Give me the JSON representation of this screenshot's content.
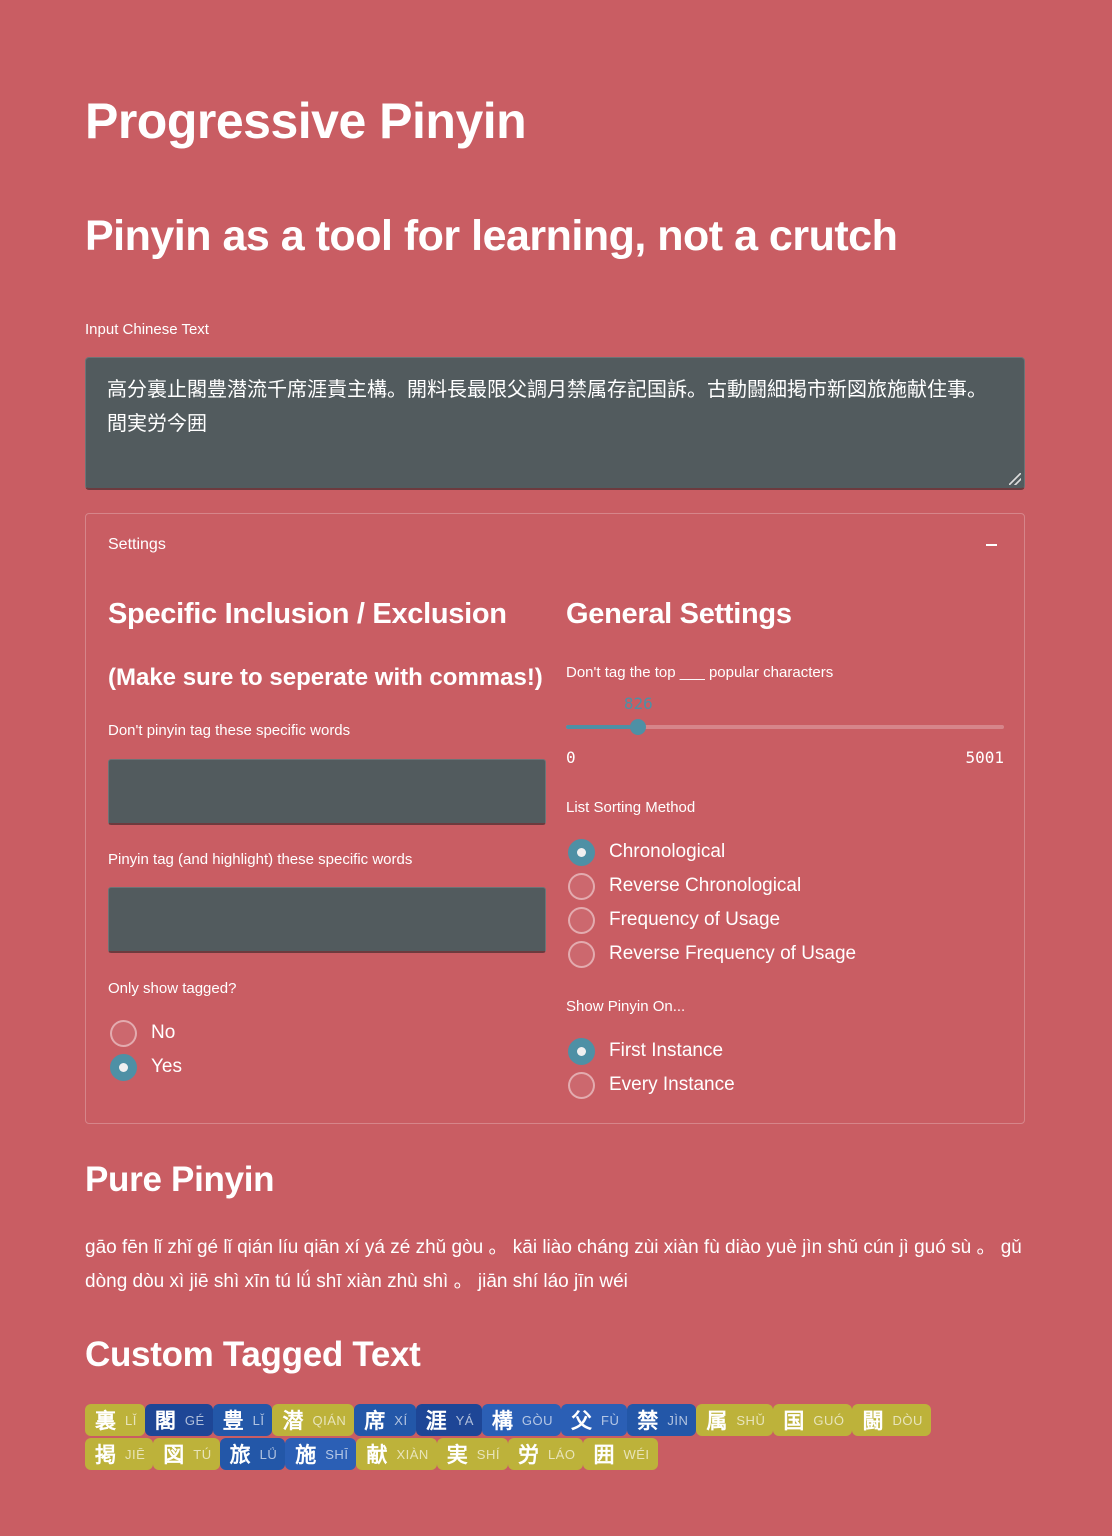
{
  "app": {
    "title": "Progressive Pinyin",
    "subtitle": "Pinyin as a tool for learning, not a crutch"
  },
  "colors": {
    "background": "#c95d63",
    "accent": "#4e90a5",
    "input_bg": "#525b5e",
    "tag_untagged": "#bdb23a",
    "tag_blue_dark": "#1e4696",
    "tag_blue_mid": "#2357a8",
    "tag_blue_light": "#2b5fb5"
  },
  "input": {
    "label": "Input Chinese Text",
    "value": "高分裏止閣豊潜流千席涯責主構。開料長最限父調月禁属存記国訴。古動闘細掲市新図旅施献住事。間実労今囲"
  },
  "settings": {
    "header": "Settings",
    "collapse_icon": "minus-icon",
    "left": {
      "heading": "Specific Inclusion / Exclusion",
      "subheading": "(Make sure to seperate with commas!)",
      "exclude_label": "Don't pinyin tag these specific words",
      "exclude_value": "",
      "include_label": "Pinyin tag (and highlight) these specific words",
      "include_value": "",
      "only_tagged": {
        "label": "Only show tagged?",
        "options": [
          "No",
          "Yes"
        ],
        "selected": "Yes"
      }
    },
    "right": {
      "heading": "General Settings",
      "slider": {
        "label": "Don't tag the top ___ popular characters",
        "value": 826,
        "min": 0,
        "max": 5001,
        "value_text": "826",
        "min_text": "0",
        "max_text": "5001"
      },
      "sorting": {
        "label": "List Sorting Method",
        "options": [
          "Chronological",
          "Reverse Chronological",
          "Frequency of Usage",
          "Reverse Frequency of Usage"
        ],
        "selected": "Chronological"
      },
      "show_pinyin": {
        "label": "Show Pinyin On...",
        "options": [
          "First Instance",
          "Every Instance"
        ],
        "selected": "First Instance"
      }
    }
  },
  "pure_pinyin": {
    "heading": "Pure Pinyin",
    "text": "gāo fēn lǐ zhǐ gé lǐ qián líu qiān xí yá zé zhǔ gòu 。 kāi liào cháng zùi xiàn fù diào yuè jìn shǔ cún jì guó sù 。 gǔ dòng dòu xì jiē shì xīn tú lǘ shī xiàn zhù shì 。 jiān shí láo jīn wéi"
  },
  "custom_tagged": {
    "heading": "Custom Tagged Text",
    "tags": [
      {
        "hanzi": "裏",
        "pinyin": "lǐ",
        "color": "olive"
      },
      {
        "hanzi": "閣",
        "pinyin": "gé",
        "color": "blue_dark"
      },
      {
        "hanzi": "豊",
        "pinyin": "lǐ",
        "color": "blue_mid"
      },
      {
        "hanzi": "潜",
        "pinyin": "qián",
        "color": "olive"
      },
      {
        "hanzi": "席",
        "pinyin": "xí",
        "color": "blue_mid"
      },
      {
        "hanzi": "涯",
        "pinyin": "yá",
        "color": "blue_dark"
      },
      {
        "hanzi": "構",
        "pinyin": "gòu",
        "color": "blue_light"
      },
      {
        "hanzi": "父",
        "pinyin": "fù",
        "color": "blue_light"
      },
      {
        "hanzi": "禁",
        "pinyin": "jìn",
        "color": "blue_mid"
      },
      {
        "hanzi": "属",
        "pinyin": "shǔ",
        "color": "olive"
      },
      {
        "hanzi": "国",
        "pinyin": "guó",
        "color": "olive"
      },
      {
        "hanzi": "闘",
        "pinyin": "dòu",
        "color": "olive"
      },
      {
        "hanzi": "掲",
        "pinyin": "jiē",
        "color": "olive"
      },
      {
        "hanzi": "図",
        "pinyin": "tú",
        "color": "olive"
      },
      {
        "hanzi": "旅",
        "pinyin": "lǘ",
        "color": "blue_mid"
      },
      {
        "hanzi": "施",
        "pinyin": "shī",
        "color": "blue_light"
      },
      {
        "hanzi": "献",
        "pinyin": "xiàn",
        "color": "olive"
      },
      {
        "hanzi": "実",
        "pinyin": "shí",
        "color": "olive"
      },
      {
        "hanzi": "労",
        "pinyin": "láo",
        "color": "olive"
      },
      {
        "hanzi": "囲",
        "pinyin": "wéi",
        "color": "olive"
      }
    ]
  }
}
